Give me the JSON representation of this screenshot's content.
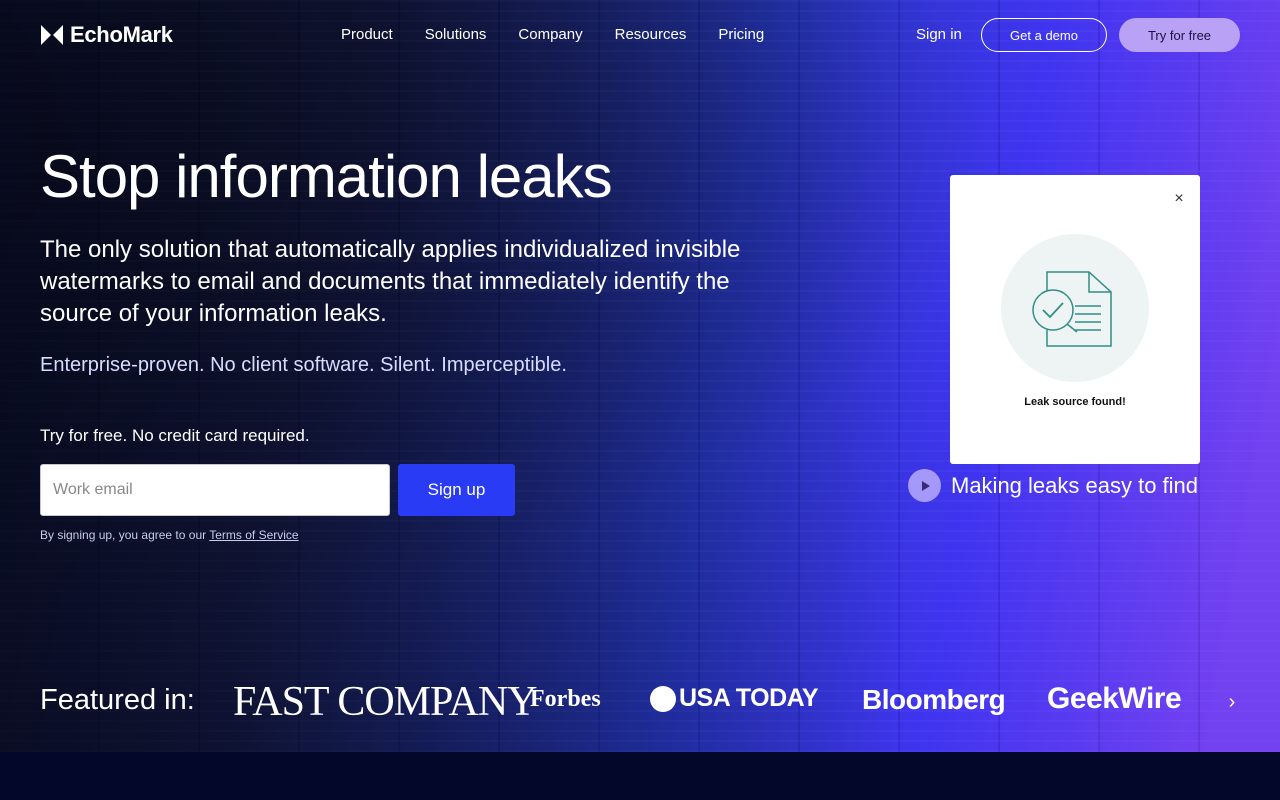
{
  "brand": {
    "name": "EchoMark"
  },
  "nav": {
    "items": [
      "Product",
      "Solutions",
      "Company",
      "Resources",
      "Pricing"
    ]
  },
  "header": {
    "sign_in": "Sign in",
    "get_demo": "Get a demo",
    "try_free": "Try for free"
  },
  "hero": {
    "title": "Stop information leaks",
    "lead": "The only solution that automatically applies individualized invisible watermarks to email and documents that immediately identify the source of your information leaks.",
    "tagline": "Enterprise-proven. No client software. Silent. Imperceptible.",
    "try_text": "Try for free. No credit card required.",
    "email_placeholder": "Work email",
    "signup_label": "Sign up",
    "terms_prefix": "By signing up, you agree to our ",
    "terms_link": "Terms of Service"
  },
  "card": {
    "close": "×",
    "label": "Leak source found!"
  },
  "video": {
    "label": "Making leaks easy to find"
  },
  "featured": {
    "label": "Featured in:",
    "logos": [
      "FAST COMPANY",
      "Forbes",
      "USA TODAY",
      "Bloomberg",
      "GeekWire"
    ]
  },
  "colors": {
    "accent": "#2a3bf5",
    "try_button": "#b9a2f5",
    "background": "#050a2a"
  },
  "icons": {
    "logo": "echomark-logo-icon",
    "close": "close-icon",
    "document": "document-check-icon",
    "play": "play-icon",
    "next": "chevron-right-icon"
  }
}
